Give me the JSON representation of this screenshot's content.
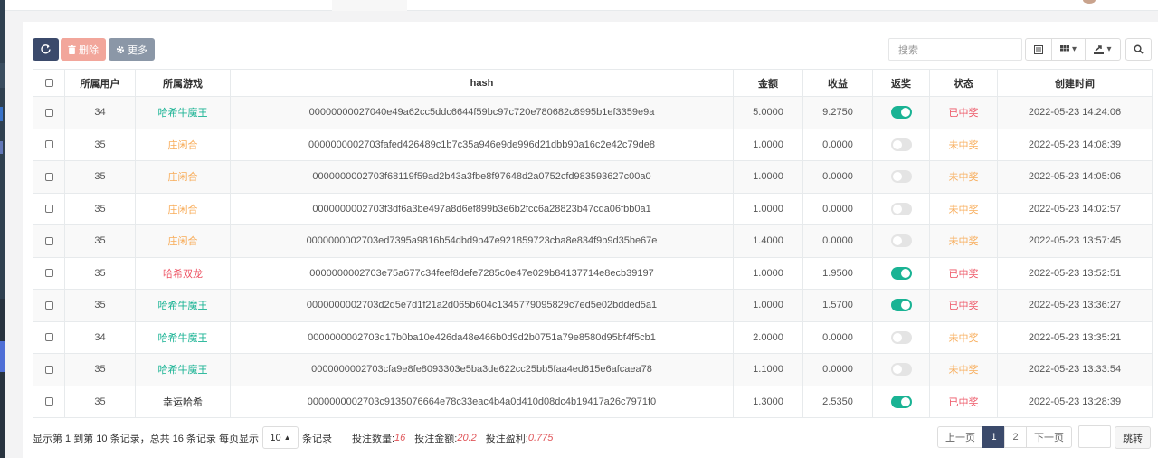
{
  "colors": {
    "accent": "#1ab394",
    "primary": "#3b4a6b",
    "danger": "#f2a69b",
    "game_teal": "#1ab394",
    "game_orange": "#f8ac59",
    "game_red": "#ed5565",
    "status_won": "#ed5565",
    "status_lost": "#f8ac59"
  },
  "toolbar": {
    "refresh_icon": "refresh-icon",
    "delete_icon": "trash-icon",
    "delete_label": "删除",
    "more_icon": "gear-icon",
    "more_label": "更多",
    "search_placeholder": "搜索"
  },
  "table": {
    "headers": {
      "user": "所属用户",
      "game": "所属游戏",
      "hash": "hash",
      "amount": "金额",
      "profit": "收益",
      "rebate": "返奖",
      "status": "状态",
      "created": "创建时间"
    },
    "rows": [
      {
        "user": "34",
        "game": "哈希牛魔王",
        "game_color": "#1ab394",
        "hash": "00000000027040e49a62cc5ddc6644f59bc97c720e780682c8995b1ef3359e9a",
        "amount": "5.0000",
        "profit": "9.2750",
        "rebate_on": true,
        "status": "已中奖",
        "status_color": "#ed5565",
        "created": "2022-05-23 14:24:06"
      },
      {
        "user": "35",
        "game": "庄闲合",
        "game_color": "#f8ac59",
        "hash": "0000000002703fafed426489c1b7c35a946e9de996d21dbb90a16c2e42c79de8",
        "amount": "1.0000",
        "profit": "0.0000",
        "rebate_on": false,
        "status": "未中奖",
        "status_color": "#f8ac59",
        "created": "2022-05-23 14:08:39"
      },
      {
        "user": "35",
        "game": "庄闲合",
        "game_color": "#f8ac59",
        "hash": "0000000002703f68119f59ad2b43a3fbe8f97648d2a0752cfd983593627c00a0",
        "amount": "1.0000",
        "profit": "0.0000",
        "rebate_on": false,
        "status": "未中奖",
        "status_color": "#f8ac59",
        "created": "2022-05-23 14:05:06"
      },
      {
        "user": "35",
        "game": "庄闲合",
        "game_color": "#f8ac59",
        "hash": "0000000002703f3df6a3be497a8d6ef899b3e6b2fcc6a28823b47cda06fbb0a1",
        "amount": "1.0000",
        "profit": "0.0000",
        "rebate_on": false,
        "status": "未中奖",
        "status_color": "#f8ac59",
        "created": "2022-05-23 14:02:57"
      },
      {
        "user": "35",
        "game": "庄闲合",
        "game_color": "#f8ac59",
        "hash": "0000000002703ed7395a9816b54dbd9b47e921859723cba8e834f9b9d35be67e",
        "amount": "1.4000",
        "profit": "0.0000",
        "rebate_on": false,
        "status": "未中奖",
        "status_color": "#f8ac59",
        "created": "2022-05-23 13:57:45"
      },
      {
        "user": "35",
        "game": "哈希双龙",
        "game_color": "#ed5565",
        "hash": "0000000002703e75a677c34feef8defe7285c0e47e029b84137714e8ecb39197",
        "amount": "1.0000",
        "profit": "1.9500",
        "rebate_on": true,
        "status": "已中奖",
        "status_color": "#ed5565",
        "created": "2022-05-23 13:52:51"
      },
      {
        "user": "35",
        "game": "哈希牛魔王",
        "game_color": "#1ab394",
        "hash": "0000000002703d2d5e7d1f21a2d065b604c1345779095829c7ed5e02bdded5a1",
        "amount": "1.0000",
        "profit": "1.5700",
        "rebate_on": true,
        "status": "已中奖",
        "status_color": "#ed5565",
        "created": "2022-05-23 13:36:27"
      },
      {
        "user": "34",
        "game": "哈希牛魔王",
        "game_color": "#1ab394",
        "hash": "0000000002703d17b0ba10e426da48e466b0d9d2b0751a79e8580d95bf4f5cb1",
        "amount": "2.0000",
        "profit": "0.0000",
        "rebate_on": false,
        "status": "未中奖",
        "status_color": "#f8ac59",
        "created": "2022-05-23 13:35:21"
      },
      {
        "user": "35",
        "game": "哈希牛魔王",
        "game_color": "#1ab394",
        "hash": "0000000002703cfa9e8fe8093303e5ba3de622cc25bb5faa4ed615e6afcaea78",
        "amount": "1.1000",
        "profit": "0.0000",
        "rebate_on": false,
        "status": "未中奖",
        "status_color": "#f8ac59",
        "created": "2022-05-23 13:33:54"
      },
      {
        "user": "35",
        "game": "幸运哈希",
        "game_color": "#333333",
        "hash": "0000000002703c9135076664e78c33eac4b4a0d410d08dc4b19417a26c7971f0",
        "amount": "1.3000",
        "profit": "2.5350",
        "rebate_on": true,
        "status": "已中奖",
        "status_color": "#ed5565",
        "created": "2022-05-23 13:28:39"
      }
    ]
  },
  "footer": {
    "range_text": "显示第 1 到第 10 条记录，总共 16 条记录 每页显示",
    "page_size": "10",
    "per_page_suffix": "条记录",
    "count_label": "投注数量:",
    "count_value": "16",
    "amount_label": "投注金额:",
    "amount_value": "20.2",
    "profit_label": "投注盈利:",
    "profit_value": "0.775"
  },
  "pagination": {
    "prev": "上一页",
    "pages": [
      "1",
      "2"
    ],
    "current": "1",
    "next": "下一页",
    "jump": "跳转"
  }
}
